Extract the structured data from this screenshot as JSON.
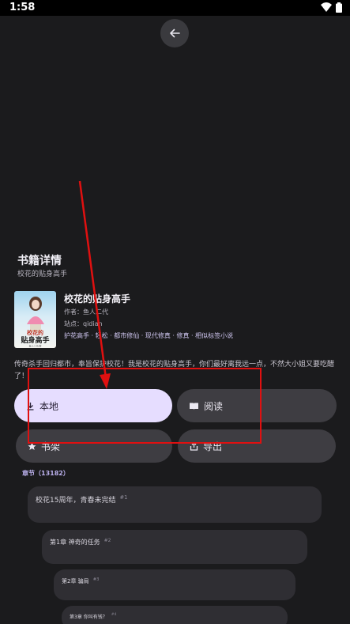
{
  "status_bar": {
    "time": "1:58",
    "icons": [
      "wifi-icon",
      "battery-icon"
    ]
  },
  "header": {
    "back_icon": "arrow-left-icon"
  },
  "section": {
    "title": "书籍详情",
    "subtitle": "校花的贴身高手"
  },
  "book": {
    "title": "校花的贴身高手",
    "author": "作者：鱼人二代",
    "site": "站点：qidian",
    "tags": "护花高手 · 轻松 · 都市修仙 · 现代修真 · 修真 · 相似标签小说",
    "cover_title": "校花的贴身高手",
    "cover_author": "鱼人二代/著",
    "intro": "传奇杀手回归都市，奉旨保护校花！我是校花的贴身高手，你们最好离我远一点，不然大小姐又要吃醋了！"
  },
  "actions": {
    "local_label": "本地",
    "read_label": "阅读",
    "shelf_label": "书架",
    "export_label": "导出"
  },
  "chapters": {
    "header": "章节（13182）",
    "items": [
      {
        "title": "校花15周年，青春未完结",
        "num": "#1"
      },
      {
        "title": "第1章 神奇的任务",
        "num": "#2"
      },
      {
        "title": "第2章 骗局",
        "num": "#3"
      },
      {
        "title": "第3章 你叫有钱？",
        "num": "#4"
      }
    ]
  },
  "colors": {
    "background": "#1b1b1d",
    "primary_button": "#e6ddff",
    "secondary_button": "#3e3d42",
    "chapter_card": "#2f2e33",
    "annotation": "#e01010"
  }
}
